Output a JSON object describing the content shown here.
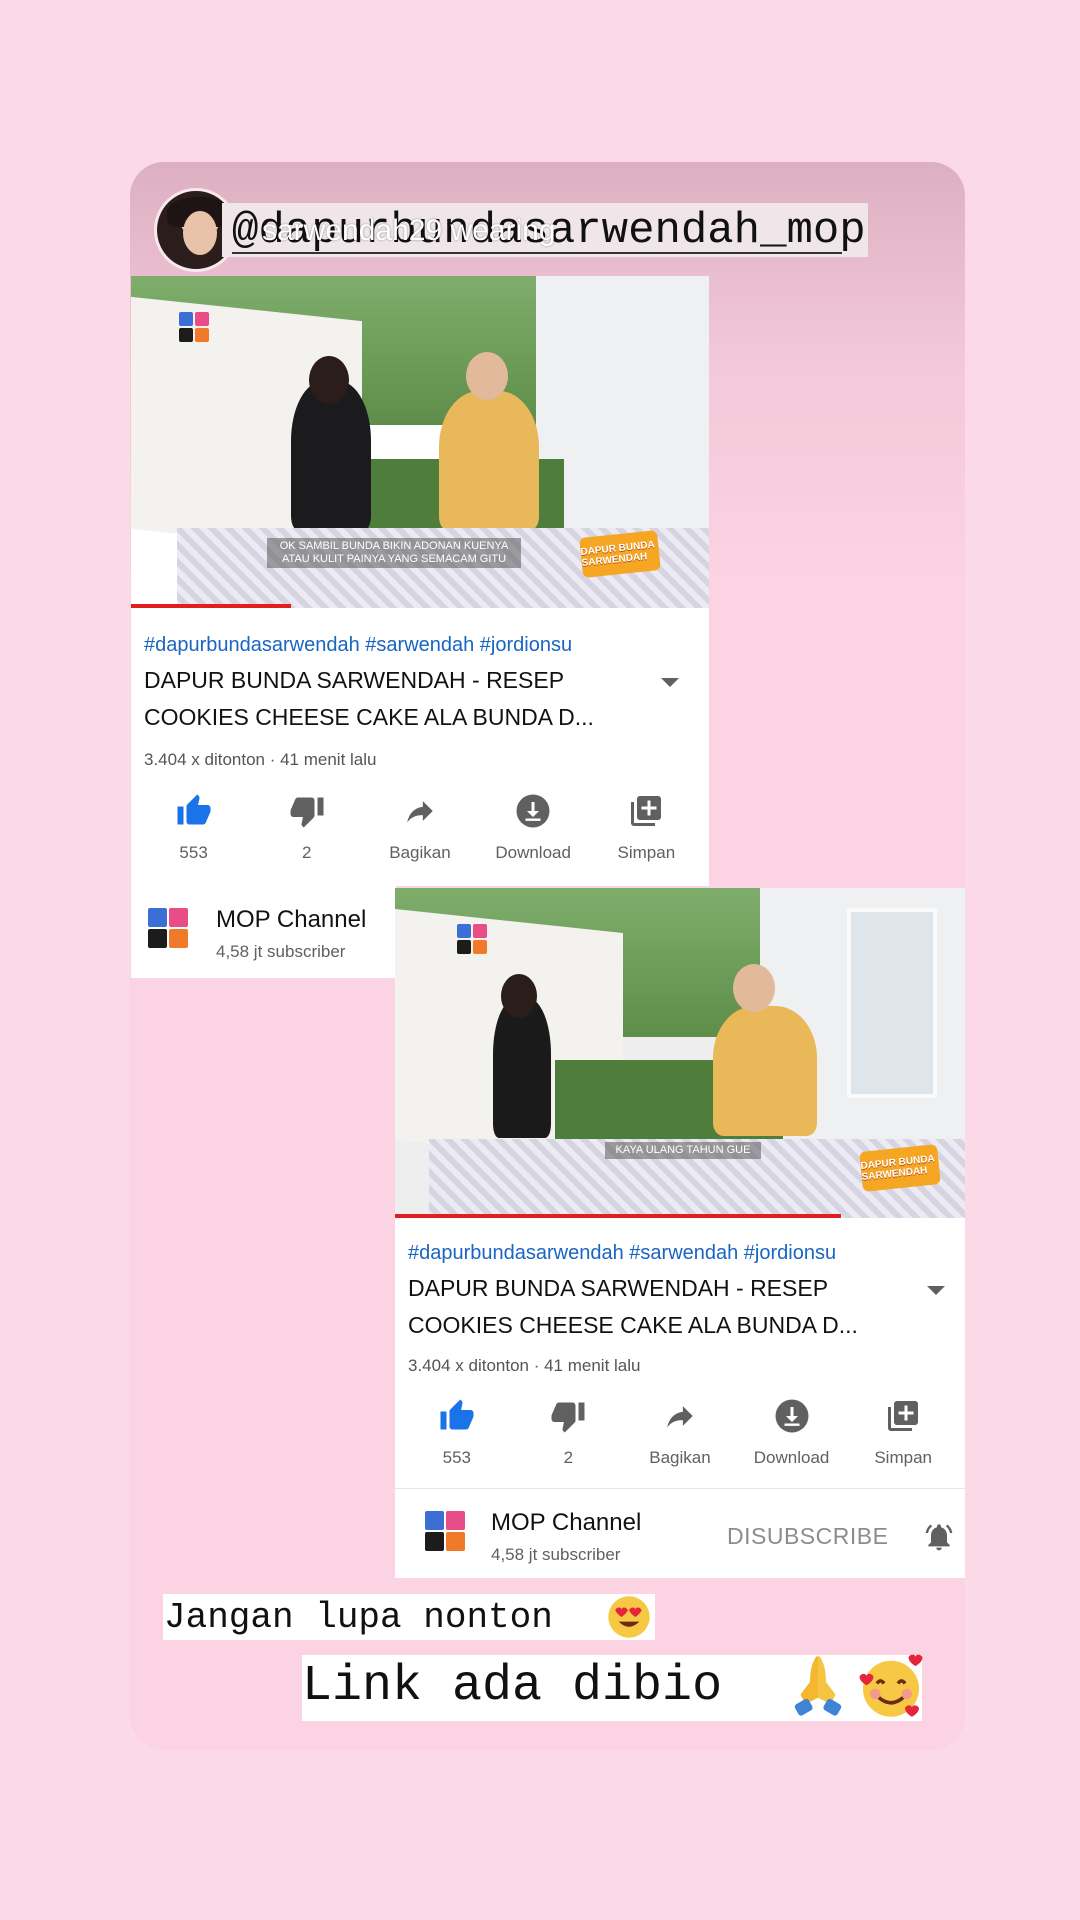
{
  "story": {
    "username_mention": "@dapurbundasarwendah_mop",
    "username_overlay": "sarwendah29 wearing"
  },
  "video_1": {
    "caption": "OK SAMBIL BUNDA BIKIN ADONAN KUENYA ATAU KULIT PAINYA YANG SEMACAM GITU",
    "show_badge": "DAPUR BUNDA SARWENDAH"
  },
  "video_2": {
    "caption": "KAYA ULANG TAHUN GUE",
    "show_badge": "DAPUR BUNDA SARWENDAH"
  },
  "meta": {
    "hashtags": "#dapurbundasarwendah #sarwendah #jordionsu",
    "title": "DAPUR BUNDA SARWENDAH - RESEP COOKIES CHEESE CAKE ALA BUNDA D...",
    "views": "3.404 x ditonton · 41 menit lalu"
  },
  "actions": [
    {
      "label": "553",
      "icon": "thumbs-up-icon"
    },
    {
      "label": "2",
      "icon": "thumbs-down-icon"
    },
    {
      "label": "Bagikan",
      "icon": "share-icon"
    },
    {
      "label": "Download",
      "icon": "download-icon"
    },
    {
      "label": "Simpan",
      "icon": "save-playlist-icon"
    }
  ],
  "channel": {
    "name": "MOP Channel",
    "subscribers": "4,58 jt subscriber",
    "subscribe_button": "DISUBSCRIBE"
  },
  "captions": {
    "line1": "Jangan lupa nonton",
    "line2": "Link ada dibio"
  },
  "colors": {
    "background": "#fbd9e7",
    "hashtag": "#1a64c4",
    "like_active": "#1a73e8",
    "progress": "#e0201f"
  }
}
